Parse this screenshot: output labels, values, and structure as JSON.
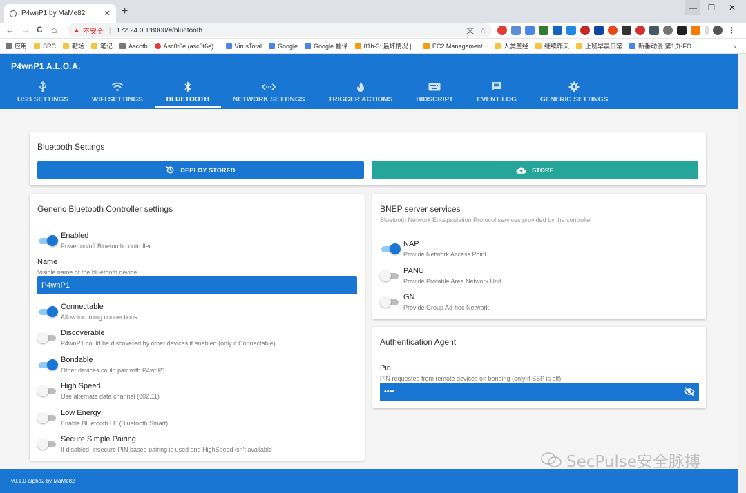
{
  "browser": {
    "tab_title": "P4wnP1 by MaMe82",
    "tab_close": "✕",
    "new_tab": "+",
    "win_min": "—",
    "win_max": "☐",
    "win_close": "✕",
    "nav_back": "←",
    "nav_forward": "→",
    "nav_reload": "C",
    "nav_home": "⌂",
    "warn_icon": "▲",
    "insecure_label": "不安全",
    "url": "172.24.0.1:8000/#/bluetooth",
    "translate_icon": "文",
    "star_icon": "☆",
    "bookmarks": [
      {
        "label": "应用",
        "icon": "gray"
      },
      {
        "label": "SRC",
        "icon": "folder"
      },
      {
        "label": "靶场",
        "icon": "folder"
      },
      {
        "label": "笔记",
        "icon": "folder"
      },
      {
        "label": "Ascotb",
        "icon": "gray"
      },
      {
        "label": "Asc0t6e (asc0t6e)...",
        "icon": "red"
      },
      {
        "label": "VirusTotal",
        "icon": "blue"
      },
      {
        "label": "Google",
        "icon": "blue"
      },
      {
        "label": "Google 翻译",
        "icon": "blue"
      },
      {
        "label": "01b-3: 最坏情况 |...",
        "icon": "orange"
      },
      {
        "label": "EC2 Management...",
        "icon": "orange"
      },
      {
        "label": "人类圣经",
        "icon": "folder"
      },
      {
        "label": "继续昨天",
        "icon": "folder"
      },
      {
        "label": "上班早晨日常",
        "icon": "folder"
      },
      {
        "label": "新番动漫 第1页-FO...",
        "icon": "blue"
      }
    ],
    "bookmarks_more": "»"
  },
  "app": {
    "title": "P4wnP1 A.L.O.A.",
    "tabs": [
      {
        "label": "USB SETTINGS",
        "icon": "usb-icon"
      },
      {
        "label": "WIFI SETTINGS",
        "icon": "wifi-icon"
      },
      {
        "label": "BLUETOOTH",
        "icon": "bluetooth-icon",
        "active": true
      },
      {
        "label": "NETWORK SETTINGS",
        "icon": "network-icon"
      },
      {
        "label": "TRIGGER ACTIONS",
        "icon": "fire-icon"
      },
      {
        "label": "HIDSCRIPT",
        "icon": "keyboard-icon"
      },
      {
        "label": "EVENT LOG",
        "icon": "message-icon"
      },
      {
        "label": "GENERIC SETTINGS",
        "icon": "gear-icon"
      }
    ]
  },
  "bt_settings": {
    "title": "Bluetooth Settings",
    "deploy_label": "DEPLOY STORED",
    "store_label": "STORE"
  },
  "controller": {
    "title": "Generic Bluetooth Controller settings",
    "enabled": {
      "label": "Enabled",
      "desc": "Power on/off Bluetooth controller",
      "on": true
    },
    "name": {
      "label": "Name",
      "desc": "Visible name of the bluetooth device",
      "value": "P4wnP1"
    },
    "options": [
      {
        "label": "Connectable",
        "desc": "Allow incoming connections",
        "on": true
      },
      {
        "label": "Discoverable",
        "desc": "P4wnP1 could be discovered by other devices if enabled (only if Connectable)",
        "on": false
      },
      {
        "label": "Bondable",
        "desc": "Other devices could pair with P4wnP1",
        "on": true
      },
      {
        "label": "High Speed",
        "desc": "Use alternate data channel (802.11)",
        "on": false
      },
      {
        "label": "Low Energy",
        "desc": "Enable Bluetooth LE (Bluetooth Smart)",
        "on": false
      },
      {
        "label": "Secure Simple Pairing",
        "desc": "If disabled, insecure PIN based pairing is used and HighSpeed isn't available",
        "on": false
      }
    ]
  },
  "bnep": {
    "title": "BNEP server services",
    "subtitle": "Bluetooth Network Encapsulation Protocol services provided by the controller",
    "services": [
      {
        "label": "NAP",
        "desc": "Provide Network Access Point",
        "on": true
      },
      {
        "label": "PANU",
        "desc": "Provide Protable Area Network Unit",
        "on": false
      },
      {
        "label": "GN",
        "desc": "Provide Group Ad-hoc Network",
        "on": false
      }
    ]
  },
  "auth": {
    "title": "Authentication Agent",
    "pin_label": "Pin",
    "pin_desc": "PIN requested from remote devices on bonding (only if SSP is off)",
    "pin_value": "••••"
  },
  "footer": {
    "text": "v0.1.0-alpha2 by MaMe82"
  },
  "watermark": {
    "text": "SecPulse安全脉搏"
  },
  "colors": {
    "primary": "#1976d2",
    "accent": "#26a69a",
    "switch_on": "#1976d2",
    "switch_track_on": "#90caf9"
  }
}
